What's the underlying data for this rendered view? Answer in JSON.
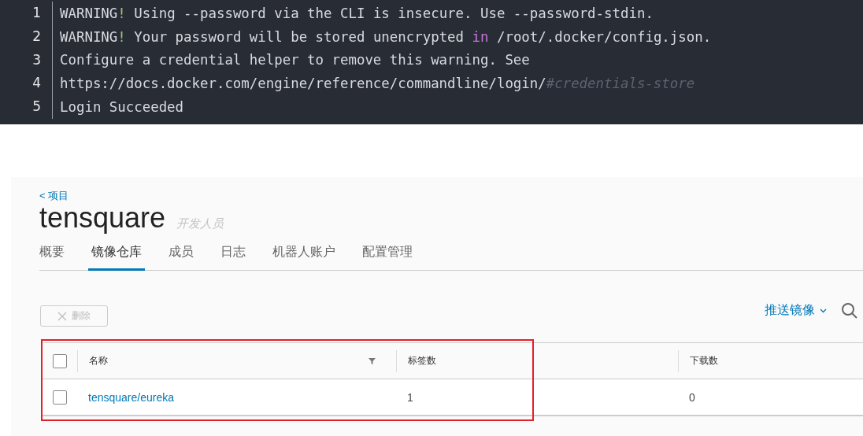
{
  "code": {
    "lines": [
      {
        "number": "1",
        "segments": [
          {
            "kind": "plain",
            "text": "WARNING"
          },
          {
            "kind": "punct",
            "text": "!"
          },
          {
            "kind": "plain",
            "text": " Using --password via the CLI is insecure. Use --password-stdin."
          }
        ]
      },
      {
        "number": "2",
        "segments": [
          {
            "kind": "plain",
            "text": "WARNING"
          },
          {
            "kind": "punct",
            "text": "!"
          },
          {
            "kind": "plain",
            "text": " Your password will be stored unencrypted "
          },
          {
            "kind": "keyword",
            "text": "in"
          },
          {
            "kind": "plain",
            "text": " /root/.docker/config.json."
          }
        ]
      },
      {
        "number": "3",
        "segments": [
          {
            "kind": "plain",
            "text": "Configure a credential helper to remove this warning. See"
          }
        ]
      },
      {
        "number": "4",
        "segments": [
          {
            "kind": "plain",
            "text": "https://docs.docker.com/engine/reference/commandline/login/"
          },
          {
            "kind": "comment",
            "text": "#credentials-store"
          }
        ]
      },
      {
        "number": "5",
        "segments": [
          {
            "kind": "plain",
            "text": "Login Succeeded"
          }
        ]
      }
    ]
  },
  "project": {
    "back_link": "< 项目",
    "title": "tensquare",
    "role": "开发人员",
    "tabs": [
      {
        "label": "概要",
        "selected": false
      },
      {
        "label": "镜像仓库",
        "selected": true
      },
      {
        "label": "成员",
        "selected": false
      },
      {
        "label": "日志",
        "selected": false
      },
      {
        "label": "机器人账户",
        "selected": false
      },
      {
        "label": "配置管理",
        "selected": false
      }
    ],
    "delete_button": {
      "label": "删除",
      "disabled": true
    },
    "push_button": {
      "label": "推送镜像"
    },
    "table": {
      "header_checked": false,
      "columns": [
        {
          "label": "名称",
          "filter": true
        },
        {
          "label": "标签数"
        },
        {
          "label": "下载数"
        }
      ],
      "rows": [
        {
          "checked": false,
          "name": "tensquare/eureka",
          "tags": "1",
          "downloads": "0"
        }
      ]
    }
  }
}
